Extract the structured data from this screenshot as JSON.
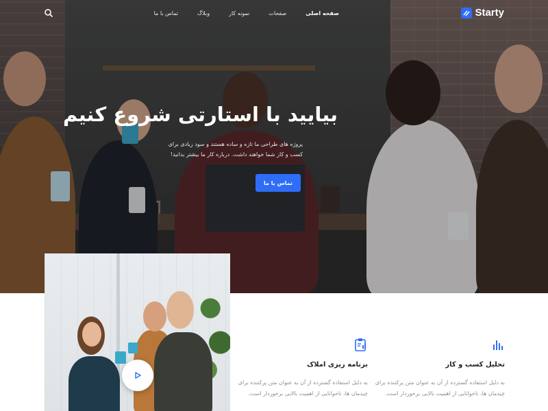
{
  "nav": {
    "brand": "Starty",
    "menu": [
      "صفحه اصلی",
      "صفحات",
      "نمونه کار",
      "وبلاگ",
      "تماس با ما"
    ],
    "active_index": 0
  },
  "hero": {
    "title": "بیایید با استارتی شروع کنیم",
    "description": "پروژه های طراحی ما تازه و ساده هستند و سود زیادی برای کسب و کار شما خواهند داشت. درباره کار ما بیشتر بدانید!",
    "cta": "تماس با ما"
  },
  "services": [
    {
      "icon": "bar-chart-icon",
      "title": "تحلیل کسب و کار",
      "text": "به دلیل استفاده گسترده از آن به عنوان متن پرکننده برای چیدمان ها، ناخوانایی از اهمیت بالایی برخوردار است."
    },
    {
      "icon": "clipboard-chart-icon",
      "title": "برنامه ریزی املاک",
      "text": "به دلیل استفاده گسترده از آن به عنوان متن پرکننده برای چیدمان ها، ناخوانایی از اهمیت بالایی برخوردار است."
    }
  ],
  "colors": {
    "accent": "#2f6df6",
    "heading": "#222222",
    "body_text": "#8b8e94"
  }
}
